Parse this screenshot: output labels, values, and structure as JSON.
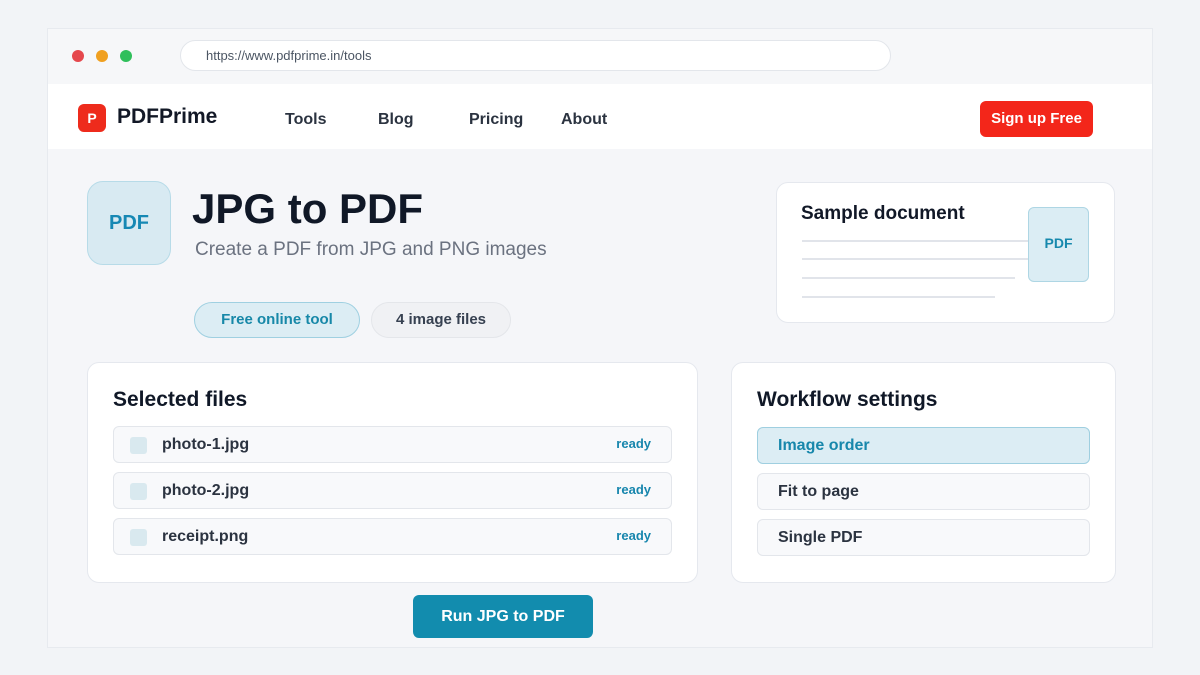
{
  "browser": {
    "url": "https://www.pdfprime.in/tools"
  },
  "header": {
    "logo_letter": "P",
    "brand": "PDFPrime",
    "nav": [
      "Tools",
      "Blog",
      "Pricing",
      "About"
    ],
    "signup_label": "Sign up Free"
  },
  "hero": {
    "icon_label": "PDF",
    "title": "JPG to PDF",
    "subtitle": "Create a PDF from JPG and PNG images",
    "pills": [
      "Free online tool",
      "4 image files"
    ]
  },
  "sample": {
    "title": "Sample document",
    "badge": "PDF"
  },
  "files": {
    "heading": "Selected files",
    "items": [
      {
        "name": "photo-1.jpg",
        "status": "ready"
      },
      {
        "name": "photo-2.jpg",
        "status": "ready"
      },
      {
        "name": "receipt.png",
        "status": "ready"
      }
    ]
  },
  "settings": {
    "heading": "Workflow settings",
    "options": [
      "Image order",
      "Fit to page",
      "Single PDF"
    ],
    "active_option": "Image order"
  },
  "run_label": "Run JPG to PDF",
  "colors": {
    "brand_red": "#f3261a",
    "accent_teal": "#128cae"
  }
}
